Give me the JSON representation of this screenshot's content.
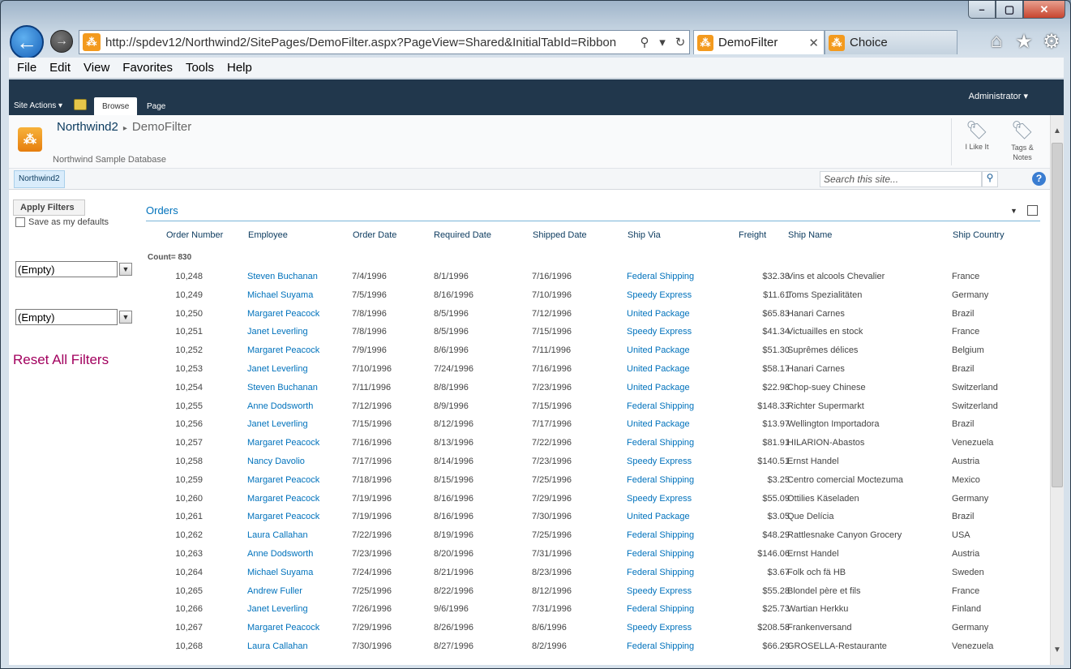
{
  "browser": {
    "url": "http://spdev12/Northwind2/SitePages/DemoFilter.aspx?PageView=Shared&InitialTabId=Ribbon",
    "tabs": [
      {
        "label": "DemoFilter",
        "active": true
      },
      {
        "label": "Choice",
        "active": false
      }
    ],
    "menu": [
      "File",
      "Edit",
      "View",
      "Favorites",
      "Tools",
      "Help"
    ]
  },
  "ribbon": {
    "site_actions": "Site Actions ▾",
    "tabs": [
      "Browse",
      "Page"
    ],
    "user": "Administrator ▾"
  },
  "site": {
    "breadcrumb_root": "Northwind2",
    "breadcrumb_page": "DemoFilter",
    "description": "Northwind Sample Database",
    "like_label": "I Like It",
    "tags_label": "Tags &\nNotes",
    "nav_item": "Northwind2",
    "search_placeholder": "Search this site..."
  },
  "filters": {
    "apply_label": "Apply Filters",
    "save_defaults": "Save as my defaults",
    "filter1": "(Empty)",
    "filter2": "(Empty)",
    "reset_label": "Reset All Filters"
  },
  "orders": {
    "title": "Orders",
    "columns": [
      "Order Number",
      "Employee",
      "Order Date",
      "Required Date",
      "Shipped Date",
      "Ship Via",
      "Freight",
      "Ship Name",
      "Ship Country"
    ],
    "count_label": "Count= 830",
    "rows": [
      [
        "10,248",
        "Steven Buchanan",
        "7/4/1996",
        "8/1/1996",
        "7/16/1996",
        "Federal Shipping",
        "$32.38",
        "Vins et alcools Chevalier",
        "France"
      ],
      [
        "10,249",
        "Michael Suyama",
        "7/5/1996",
        "8/16/1996",
        "7/10/1996",
        "Speedy Express",
        "$11.61",
        "Toms Spezialitäten",
        "Germany"
      ],
      [
        "10,250",
        "Margaret Peacock",
        "7/8/1996",
        "8/5/1996",
        "7/12/1996",
        "United Package",
        "$65.83",
        "Hanari Carnes",
        "Brazil"
      ],
      [
        "10,251",
        "Janet Leverling",
        "7/8/1996",
        "8/5/1996",
        "7/15/1996",
        "Speedy Express",
        "$41.34",
        "Victuailles en stock",
        "France"
      ],
      [
        "10,252",
        "Margaret Peacock",
        "7/9/1996",
        "8/6/1996",
        "7/11/1996",
        "United Package",
        "$51.30",
        "Suprêmes délices",
        "Belgium"
      ],
      [
        "10,253",
        "Janet Leverling",
        "7/10/1996",
        "7/24/1996",
        "7/16/1996",
        "United Package",
        "$58.17",
        "Hanari Carnes",
        "Brazil"
      ],
      [
        "10,254",
        "Steven Buchanan",
        "7/11/1996",
        "8/8/1996",
        "7/23/1996",
        "United Package",
        "$22.98",
        "Chop-suey Chinese",
        "Switzerland"
      ],
      [
        "10,255",
        "Anne Dodsworth",
        "7/12/1996",
        "8/9/1996",
        "7/15/1996",
        "Federal Shipping",
        "$148.33",
        "Richter Supermarkt",
        "Switzerland"
      ],
      [
        "10,256",
        "Janet Leverling",
        "7/15/1996",
        "8/12/1996",
        "7/17/1996",
        "United Package",
        "$13.97",
        "Wellington Importadora",
        "Brazil"
      ],
      [
        "10,257",
        "Margaret Peacock",
        "7/16/1996",
        "8/13/1996",
        "7/22/1996",
        "Federal Shipping",
        "$81.91",
        "HILARION-Abastos",
        "Venezuela"
      ],
      [
        "10,258",
        "Nancy Davolio",
        "7/17/1996",
        "8/14/1996",
        "7/23/1996",
        "Speedy Express",
        "$140.51",
        "Ernst Handel",
        "Austria"
      ],
      [
        "10,259",
        "Margaret Peacock",
        "7/18/1996",
        "8/15/1996",
        "7/25/1996",
        "Federal Shipping",
        "$3.25",
        "Centro comercial Moctezuma",
        "Mexico"
      ],
      [
        "10,260",
        "Margaret Peacock",
        "7/19/1996",
        "8/16/1996",
        "7/29/1996",
        "Speedy Express",
        "$55.09",
        "Ottilies Käseladen",
        "Germany"
      ],
      [
        "10,261",
        "Margaret Peacock",
        "7/19/1996",
        "8/16/1996",
        "7/30/1996",
        "United Package",
        "$3.05",
        "Que Delícia",
        "Brazil"
      ],
      [
        "10,262",
        "Laura Callahan",
        "7/22/1996",
        "8/19/1996",
        "7/25/1996",
        "Federal Shipping",
        "$48.29",
        "Rattlesnake Canyon Grocery",
        "USA"
      ],
      [
        "10,263",
        "Anne Dodsworth",
        "7/23/1996",
        "8/20/1996",
        "7/31/1996",
        "Federal Shipping",
        "$146.06",
        "Ernst Handel",
        "Austria"
      ],
      [
        "10,264",
        "Michael Suyama",
        "7/24/1996",
        "8/21/1996",
        "8/23/1996",
        "Federal Shipping",
        "$3.67",
        "Folk och fä HB",
        "Sweden"
      ],
      [
        "10,265",
        "Andrew Fuller",
        "7/25/1996",
        "8/22/1996",
        "8/12/1996",
        "Speedy Express",
        "$55.28",
        "Blondel père et fils",
        "France"
      ],
      [
        "10,266",
        "Janet Leverling",
        "7/26/1996",
        "9/6/1996",
        "7/31/1996",
        "Federal Shipping",
        "$25.73",
        "Wartian Herkku",
        "Finland"
      ],
      [
        "10,267",
        "Margaret Peacock",
        "7/29/1996",
        "8/26/1996",
        "8/6/1996",
        "Speedy Express",
        "$208.58",
        "Frankenversand",
        "Germany"
      ],
      [
        "10,268",
        "Laura Callahan",
        "7/30/1996",
        "8/27/1996",
        "8/2/1996",
        "Federal Shipping",
        "$66.29",
        "GROSELLA-Restaurante",
        "Venezuela"
      ]
    ]
  }
}
